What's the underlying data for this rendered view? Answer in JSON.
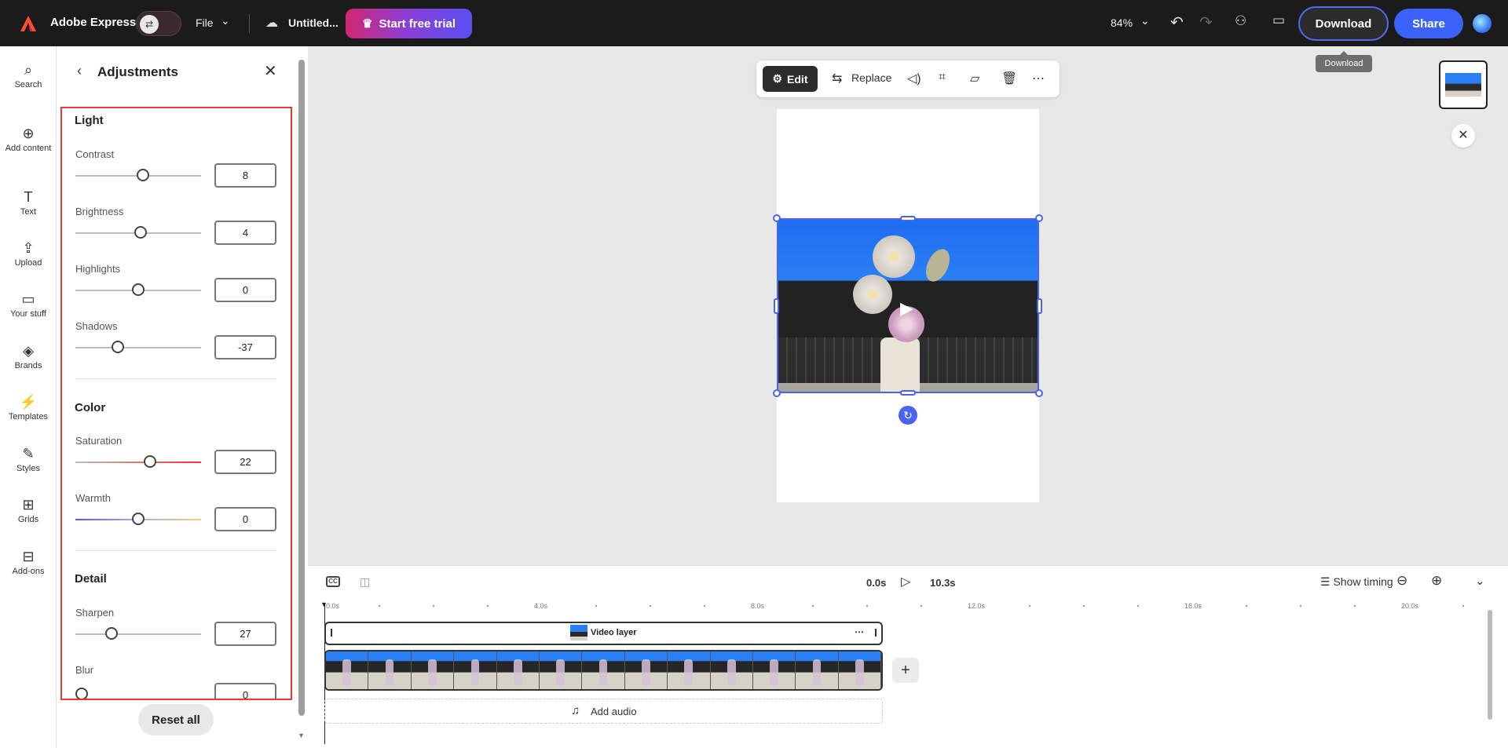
{
  "header": {
    "app_name": "Adobe Express",
    "file_menu": "File",
    "doc_title": "Untitled...",
    "trial_button": "Start free trial",
    "zoom": "84%",
    "download_button": "Download",
    "share_button": "Share",
    "tooltip": "Download"
  },
  "rail": {
    "items": [
      {
        "label": "Search",
        "icon": "search-icon"
      },
      {
        "label": "Add content",
        "icon": "plus-circle-icon"
      },
      {
        "label": "Text",
        "icon": "text-icon"
      },
      {
        "label": "Upload",
        "icon": "upload-icon"
      },
      {
        "label": "Your stuff",
        "icon": "folder-icon"
      },
      {
        "label": "Brands",
        "icon": "brand-icon"
      },
      {
        "label": "Templates",
        "icon": "templates-icon"
      },
      {
        "label": "Styles",
        "icon": "styles-icon"
      },
      {
        "label": "Grids",
        "icon": "grid-icon"
      },
      {
        "label": "Add-ons",
        "icon": "addons-icon"
      }
    ]
  },
  "panel": {
    "title": "Adjustments",
    "sections": {
      "light": "Light",
      "color": "Color",
      "detail": "Detail"
    },
    "controls": {
      "contrast": {
        "label": "Contrast",
        "value": "8"
      },
      "brightness": {
        "label": "Brightness",
        "value": "4"
      },
      "highlights": {
        "label": "Highlights",
        "value": "0"
      },
      "shadows": {
        "label": "Shadows",
        "value": "-37"
      },
      "saturation": {
        "label": "Saturation",
        "value": "22"
      },
      "warmth": {
        "label": "Warmth",
        "value": "0"
      },
      "sharpen": {
        "label": "Sharpen",
        "value": "27"
      },
      "blur": {
        "label": "Blur",
        "value": "0"
      }
    },
    "reset_button": "Reset all"
  },
  "canvas_toolbar": {
    "edit": "Edit",
    "replace": "Replace"
  },
  "timeline": {
    "current_time": "0.0s",
    "total_time": "10.3s",
    "show_timing": "Show timing",
    "ruler": [
      "0.0s",
      "4.0s",
      "8.0s",
      "12.0s",
      "16.0s",
      "20.0s"
    ],
    "video_layer": "Video layer",
    "add_audio": "Add audio"
  },
  "colors": {
    "accent": "#3b63fb",
    "highlight_box": "#e53935",
    "topbar": "#1b1b1b"
  }
}
